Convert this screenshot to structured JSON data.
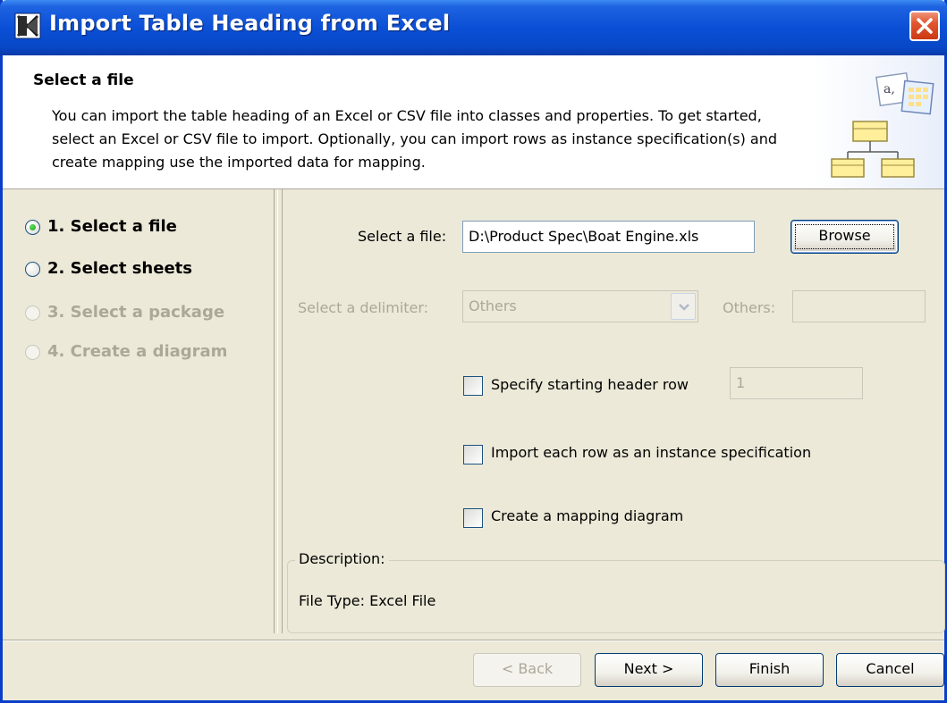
{
  "window": {
    "title": "Import Table Heading from Excel"
  },
  "header": {
    "title": "Select a file",
    "description": "You can import the table heading of an Excel or CSV file into classes and properties. To get started, select an Excel or CSV file to import. Optionally, you can import rows as instance specification(s) and create mapping use the imported data for mapping."
  },
  "steps": [
    {
      "label": "1. Select a file",
      "state": "current"
    },
    {
      "label": "2. Select sheets",
      "state": "enabled"
    },
    {
      "label": "3. Select a package",
      "state": "disabled"
    },
    {
      "label": "4. Create a diagram",
      "state": "disabled"
    }
  ],
  "form": {
    "file_label": "Select a file:",
    "file_value": "D:\\Product Spec\\Boat Engine.xls",
    "browse_label": "Browse",
    "delimiter_label": "Select a delimiter:",
    "delimiter_value": "Others",
    "others_label": "Others:",
    "others_value": "",
    "header_row_label": "Specify starting header row",
    "header_row_value": "1",
    "header_row_checked": false,
    "import_rows_label": "Import each row as an instance specification",
    "import_rows_checked": false,
    "mapping_label": "Create a mapping diagram",
    "mapping_checked": false
  },
  "description_box": {
    "legend": "Description:",
    "text": "File Type: Excel File"
  },
  "buttons": {
    "back": "< Back",
    "next": "Next >",
    "finish": "Finish",
    "cancel": "Cancel"
  },
  "colors": {
    "titlebar": "#0a4fd6",
    "dialog_bg": "#ece9d8",
    "disabled_text": "#aca899",
    "close_button": "#e1562e"
  }
}
